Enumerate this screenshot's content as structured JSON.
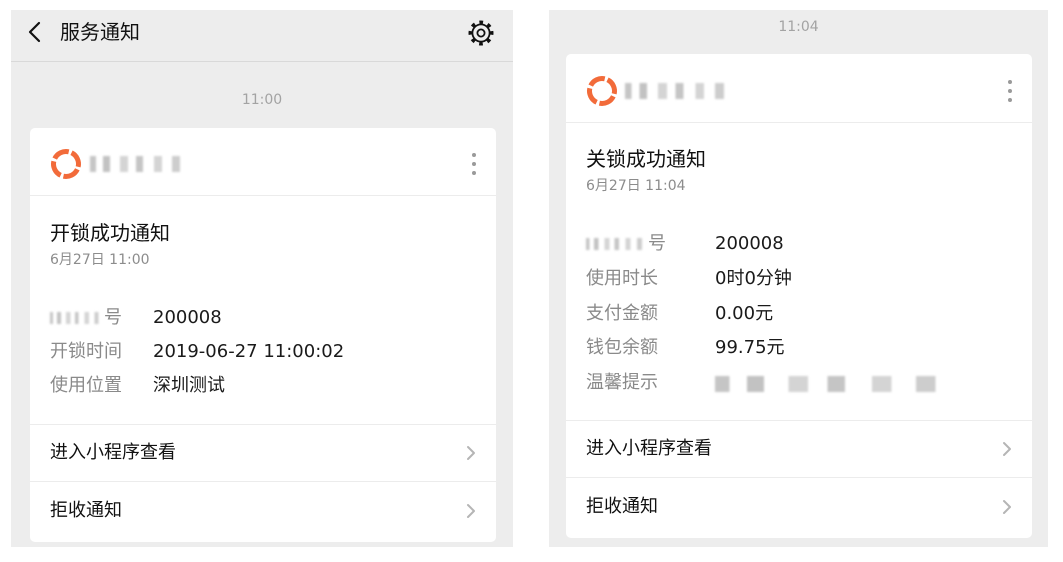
{
  "left": {
    "header": {
      "title": "服务通知"
    },
    "time": "11:00",
    "card": {
      "title": "开锁成功通知",
      "date": "6月27日 11:00",
      "rows": [
        {
          "label": "号",
          "value": "200008"
        },
        {
          "label": "开锁时间",
          "value": "2019-06-27 11:00:02"
        },
        {
          "label": "使用位置",
          "value": "深圳测试"
        }
      ],
      "actions": [
        {
          "label": "进入小程序查看"
        },
        {
          "label": "拒收通知"
        }
      ]
    }
  },
  "right": {
    "time": "11:04",
    "card": {
      "title": "关锁成功通知",
      "date": "6月27日 11:04",
      "rows": [
        {
          "label": "号",
          "value": "200008"
        },
        {
          "label": "使用时长",
          "value": "0时0分钟"
        },
        {
          "label": "支付金额",
          "value": "0.00元"
        },
        {
          "label": "钱包余额",
          "value": "99.75元"
        },
        {
          "label": "温馨提示",
          "value": ""
        }
      ],
      "actions": [
        {
          "label": "进入小程序查看"
        },
        {
          "label": "拒收通知"
        }
      ]
    }
  },
  "icons": {
    "back": "chevron-left-icon",
    "settings": "gear-icon",
    "logo": "brand-logo-icon",
    "more": "more-dots-icon",
    "chevron": "chevron-right-icon"
  },
  "colors": {
    "panel_background": "#ededed",
    "card_background": "#ffffff",
    "logo_accent": "#f26b3a",
    "label_gray": "#8a8a8a",
    "time_gray": "#a3a3a3"
  }
}
